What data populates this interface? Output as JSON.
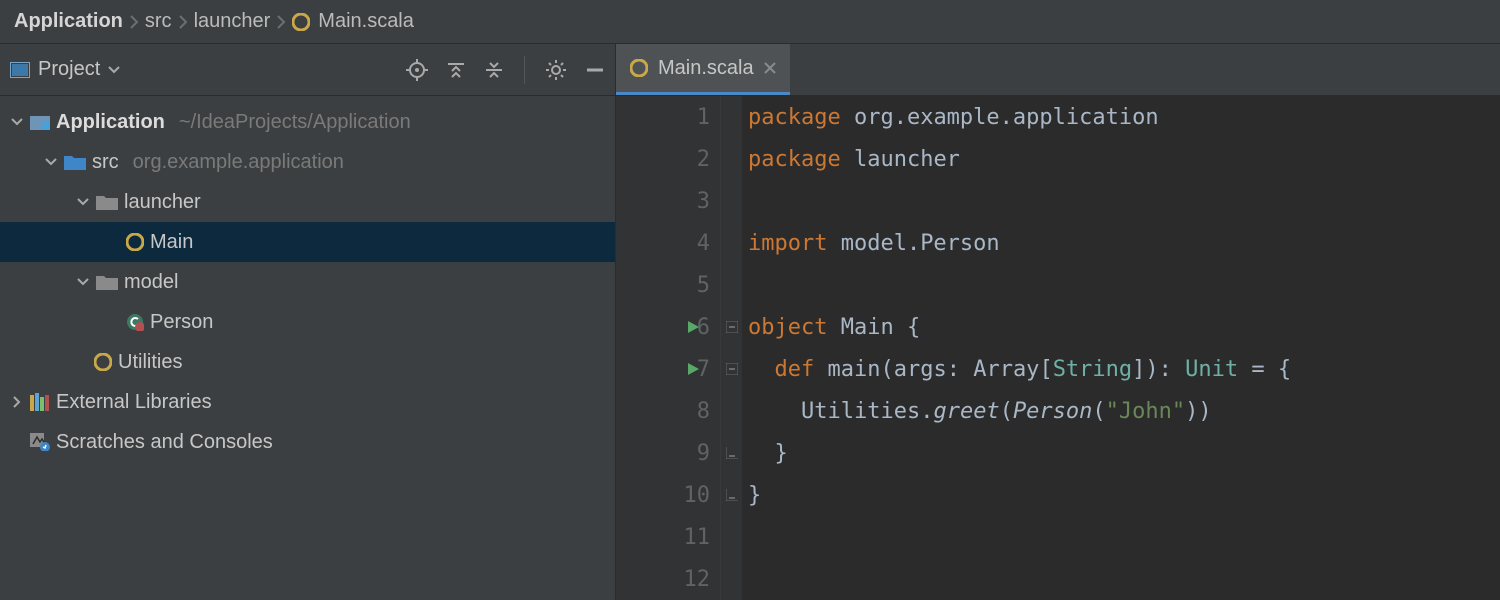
{
  "breadcrumbs": {
    "items": [
      "Application",
      "src",
      "launcher",
      "Main.scala"
    ]
  },
  "project_toolbar": {
    "label": "Project"
  },
  "editor_tabs": {
    "active": {
      "label": "Main.scala"
    }
  },
  "tree": {
    "root": {
      "name": "Application",
      "path": "~/IdeaProjects/Application"
    },
    "src": {
      "name": "src",
      "package": "org.example.application"
    },
    "launcher": {
      "name": "launcher"
    },
    "main_obj": {
      "name": "Main"
    },
    "model": {
      "name": "model"
    },
    "person": {
      "name": "Person"
    },
    "utilities": {
      "name": "Utilities"
    },
    "ext_libs": {
      "name": "External Libraries"
    },
    "scratches": {
      "name": "Scratches and Consoles"
    }
  },
  "code": {
    "lines": [
      {
        "n": 1,
        "tokens": [
          [
            "kw",
            "package "
          ],
          [
            "ident",
            "org.example.application"
          ]
        ]
      },
      {
        "n": 2,
        "tokens": [
          [
            "kw",
            "package "
          ],
          [
            "ident",
            "launcher"
          ]
        ]
      },
      {
        "n": 3,
        "tokens": []
      },
      {
        "n": 4,
        "tokens": [
          [
            "kw",
            "import "
          ],
          [
            "ident",
            "model.Person"
          ]
        ]
      },
      {
        "n": 5,
        "tokens": []
      },
      {
        "n": 6,
        "run": true,
        "fold": "open",
        "tokens": [
          [
            "kw",
            "object "
          ],
          [
            "ident",
            "Main "
          ],
          [
            "plain",
            "{"
          ]
        ]
      },
      {
        "n": 7,
        "run": true,
        "fold": "open",
        "tokens": [
          [
            "plain",
            "  "
          ],
          [
            "kw",
            "def "
          ],
          [
            "ident",
            "main"
          ],
          [
            "plain",
            "("
          ],
          [
            "ident",
            "args"
          ],
          [
            "plain",
            ": "
          ],
          [
            "ident",
            "Array"
          ],
          [
            "plain",
            "["
          ],
          [
            "type",
            "String"
          ],
          [
            "plain",
            "]): "
          ],
          [
            "type",
            "Unit"
          ],
          [
            "plain",
            " = {"
          ]
        ]
      },
      {
        "n": 8,
        "tokens": [
          [
            "plain",
            "    "
          ],
          [
            "ident",
            "Utilities"
          ],
          [
            "plain",
            "."
          ],
          [
            "call",
            "greet"
          ],
          [
            "plain",
            "("
          ],
          [
            "call",
            "Person"
          ],
          [
            "plain",
            "("
          ],
          [
            "str",
            "\"John\""
          ],
          [
            "plain",
            "))"
          ]
        ]
      },
      {
        "n": 9,
        "fold": "close",
        "tokens": [
          [
            "plain",
            "  }"
          ]
        ]
      },
      {
        "n": 10,
        "fold": "close",
        "tokens": [
          [
            "plain",
            "}"
          ]
        ]
      },
      {
        "n": 11,
        "tokens": []
      },
      {
        "n": 12,
        "tokens": []
      }
    ]
  }
}
